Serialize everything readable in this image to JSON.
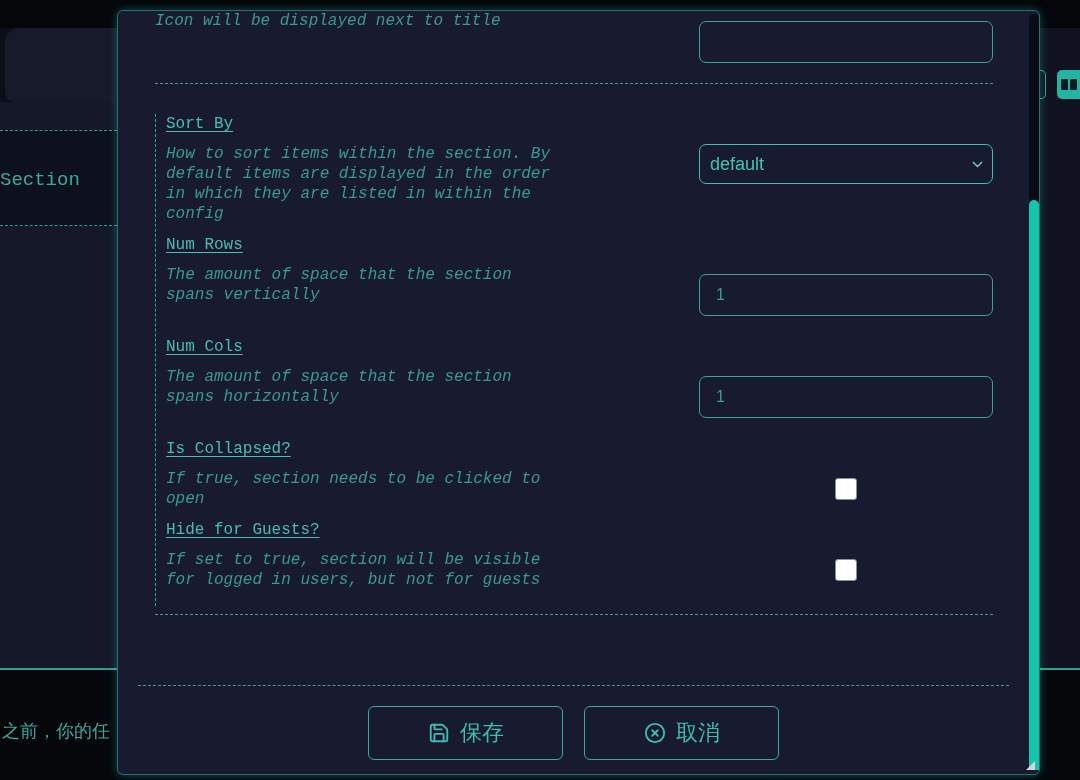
{
  "background": {
    "section_label": "Section",
    "footer_text": "之前，你的任"
  },
  "view_buttons": [
    {
      "kind": "layout",
      "selected": false
    },
    {
      "kind": "columns",
      "selected": true
    }
  ],
  "dialog": {
    "top_field": {
      "description": "Icon will be displayed next to title"
    },
    "fields": [
      {
        "kind": "select",
        "label": "Sort By",
        "description": "How to sort items within the section. By default items are displayed in the order in which they are listed in within the config",
        "value": "default"
      },
      {
        "kind": "text",
        "label": "Num Rows",
        "description": "The amount of space that the section spans vertically",
        "value": "1"
      },
      {
        "kind": "text",
        "label": "Num Cols",
        "description": "The amount of space that the section spans horizontally",
        "value": "1"
      },
      {
        "kind": "checkbox",
        "label": "Is Collapsed?",
        "description": "If true, section needs to be clicked to open",
        "checked": false
      },
      {
        "kind": "checkbox",
        "label": "Hide for Guests?",
        "description": "If set to true, section will be visible for logged in users, but not for guests",
        "checked": false
      }
    ],
    "buttons": [
      {
        "kind": "save",
        "label": "保存"
      },
      {
        "kind": "cancel",
        "label": "取消"
      }
    ]
  }
}
